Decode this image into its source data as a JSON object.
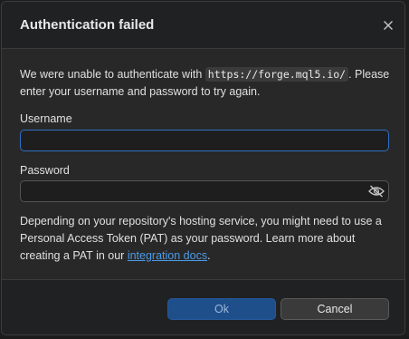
{
  "dialog": {
    "title": "Authentication failed",
    "intro_before": "We were unable to authenticate with ",
    "intro_url": "https://forge.mql5.io/",
    "intro_after": ". Please enter your username and password to try again.",
    "username_label": "Username",
    "username_value": "",
    "password_label": "Password",
    "password_value": "",
    "help_text": "Depending on your repository's hosting service, you might need to use a Personal Access Token (PAT) as your password. Learn more about creating a PAT in our ",
    "help_link": "integration docs",
    "help_after": ".",
    "ok_label": "Ok",
    "cancel_label": "Cancel"
  },
  "icons": {
    "close": "close-icon",
    "password_visibility": "eye-off-icon"
  },
  "colors": {
    "accent": "#2f6fc0",
    "link": "#4c9be8",
    "ok_button": "#1f4f8a"
  }
}
